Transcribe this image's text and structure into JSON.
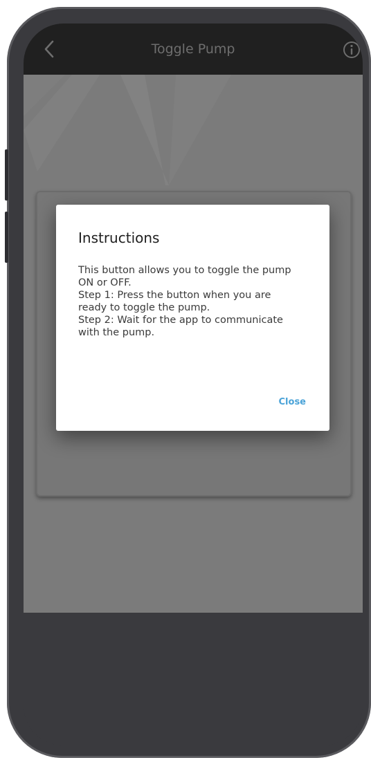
{
  "header": {
    "title": "Toggle Pump"
  },
  "dialog": {
    "title": "Instructions",
    "lines": [
      "This button allows you to toggle the pump",
      "ON or OFF.",
      "Step 1: Press the button when you are",
      "ready to toggle the pump.",
      "Step 2: Wait for the app to communicate",
      "with the pump."
    ],
    "close_label": "Close"
  },
  "colors": {
    "accent": "#4aa3d8",
    "topbar": "#202020",
    "frame": "#3a3a3e",
    "dimmed_content": "#7b7b7b"
  },
  "icons": {
    "back": "chevron-left-icon",
    "info": "info-circle-icon"
  }
}
